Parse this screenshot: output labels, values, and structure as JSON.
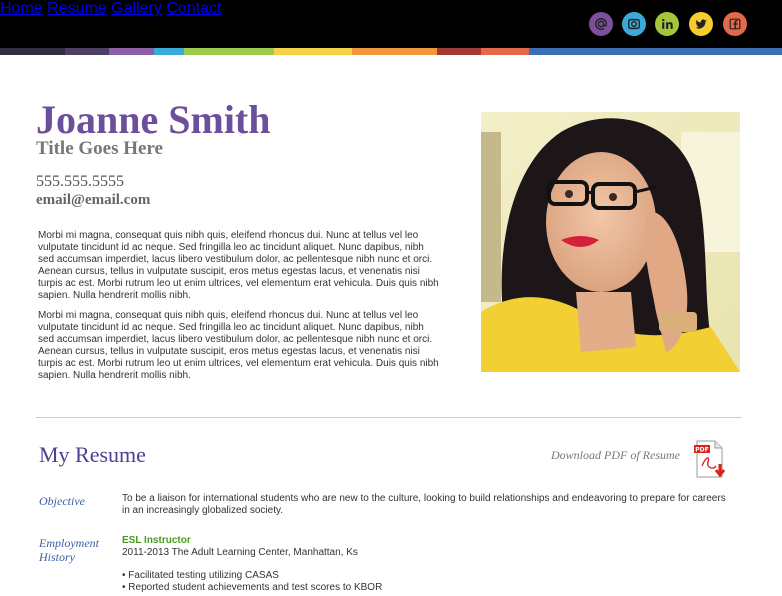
{
  "nav": {
    "items": [
      {
        "label": "Home"
      },
      {
        "label": "Resume"
      },
      {
        "label": "Gallery"
      },
      {
        "label": "Contact"
      }
    ]
  },
  "social": [
    {
      "name": "email-icon",
      "color": "#7b4f9c"
    },
    {
      "name": "instagram-icon",
      "color": "#3aaad8"
    },
    {
      "name": "linkedin-icon",
      "color": "#a4c639"
    },
    {
      "name": "twitter-icon",
      "color": "#f5cd2d"
    },
    {
      "name": "facebook-icon",
      "color": "#e26a4a"
    }
  ],
  "colors": {
    "brand_purple": "#6b4f9c",
    "stripe": [
      "#2f2f3f",
      "#4d3e63",
      "#8c5fa8",
      "#3aaad8",
      "#9fcb4c",
      "#f5d14a",
      "#f0973b",
      "#a33b34",
      "#e4674a",
      "#3b6fb6"
    ]
  },
  "profile": {
    "name": "Joanne Smith",
    "title": "Title Goes Here",
    "phone": "555.555.5555",
    "email": "email@email.com",
    "bio": [
      "Morbi mi magna, consequat quis nibh quis, eleifend rhoncus dui. Nunc at tellus vel leo vulputate tincidunt id ac neque. Sed fringilla leo ac tincidunt aliquet. Nunc dapibus, nibh sed accumsan imperdiet, lacus libero vestibulum dolor, ac pellentesque nibh nunc et orci. Aenean cursus, tellus in vulputate suscipit, eros metus egestas lacus, et venenatis nisi turpis ac est. Morbi rutrum leo ut enim ultrices, vel elementum erat vehicula. Duis quis nibh sapien. Nulla hendrerit mollis nibh.",
      "Morbi mi magna, consequat quis nibh quis, eleifend rhoncus dui. Nunc at tellus vel leo vulputate tincidunt id ac neque. Sed fringilla leo ac tincidunt aliquet. Nunc dapibus, nibh sed accumsan imperdiet, lacus libero vestibulum dolor, ac pellentesque nibh nunc et orci. Aenean cursus, tellus in vulputate suscipit, eros metus egestas lacus, et venenatis nisi turpis ac est. Morbi rutrum leo ut enim ultrices, vel elementum erat vehicula. Duis quis nibh sapien. Nulla hendrerit mollis nibh."
    ]
  },
  "resume": {
    "heading": "My Resume",
    "download_label": "Download PDF of Resume",
    "pdf_icon_text": "PDF",
    "objective": {
      "label": "Objective",
      "text": "To be a liaison for international students who are new to the culture, looking to build relationships and endeavoring to prepare for careers in an increasingly globalized society."
    },
    "employment": {
      "label": "Employment History",
      "job_title": "ESL Instructor",
      "job_line": "2011-2013 The Adult Learning Center, Manhattan, Ks",
      "bullets": [
        "Facilitated testing utilizing CASAS",
        "Reported student achievements and test scores to KBOR"
      ]
    }
  }
}
